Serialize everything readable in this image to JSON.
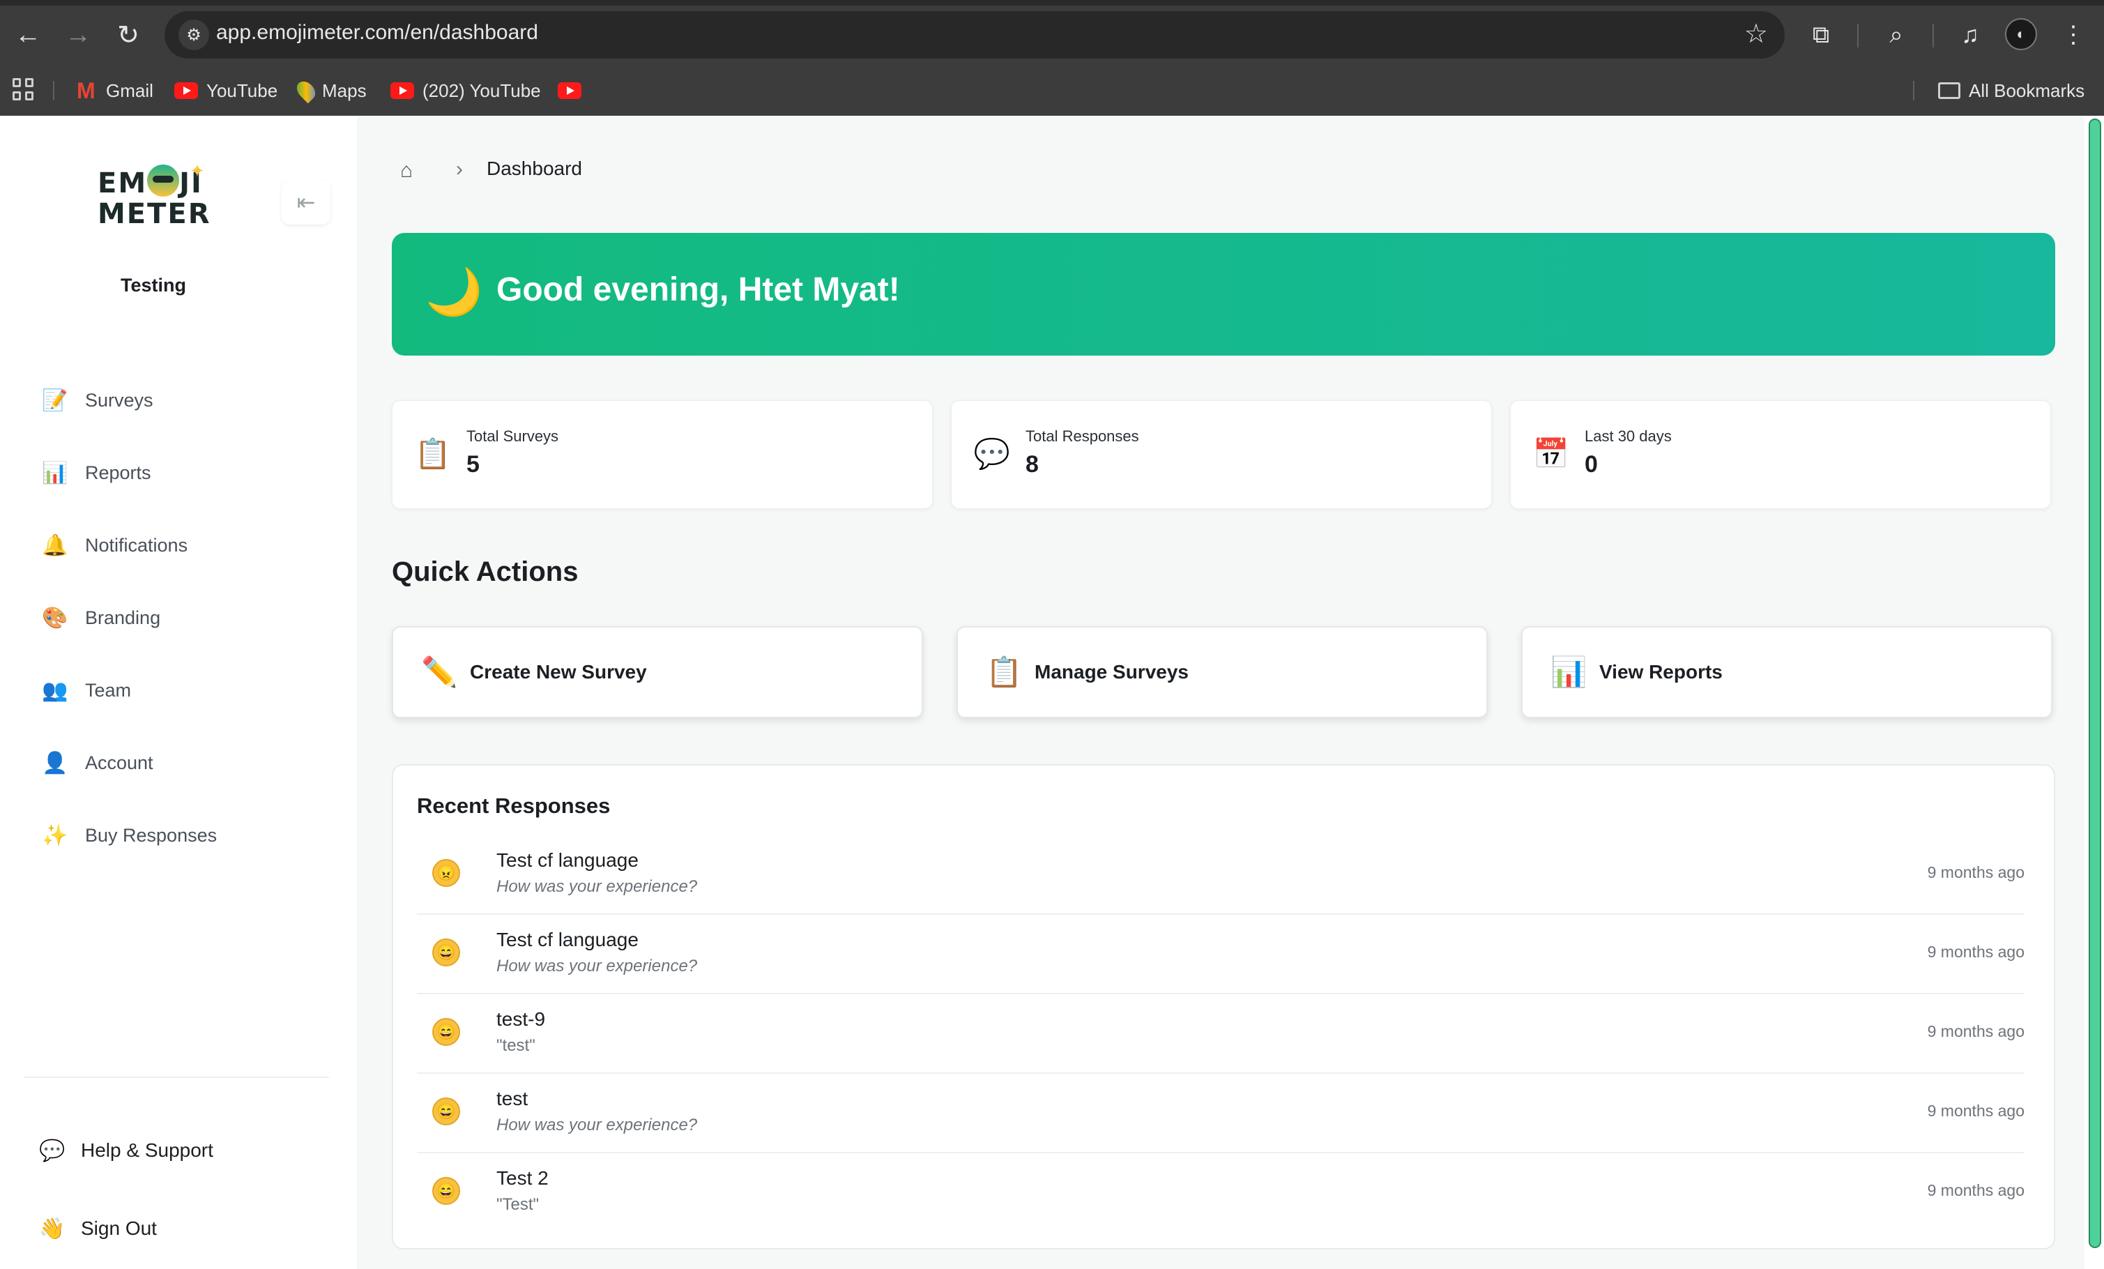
{
  "browser": {
    "url": "app.emojimeter.com/en/dashboard",
    "bookmarks": [
      {
        "label": "Gmail",
        "icon": "gmail-icon"
      },
      {
        "label": "YouTube",
        "icon": "youtube-icon"
      },
      {
        "label": "Maps",
        "icon": "maps-icon"
      },
      {
        "label": "(202) YouTube",
        "icon": "youtube-icon"
      },
      {
        "label": "",
        "icon": "youtube-icon"
      }
    ],
    "all_bookmarks_label": "All Bookmarks"
  },
  "sidebar": {
    "logo_top": "EM JI",
    "logo_bottom": "METER",
    "org_name": "Testing",
    "items": [
      {
        "label": "Surveys",
        "icon": "memo-icon",
        "glyph": "📝"
      },
      {
        "label": "Reports",
        "icon": "bar-chart-icon",
        "glyph": "📊"
      },
      {
        "label": "Notifications",
        "icon": "bell-icon",
        "glyph": "🔔"
      },
      {
        "label": "Branding",
        "icon": "palette-icon",
        "glyph": "🎨"
      },
      {
        "label": "Team",
        "icon": "team-icon",
        "glyph": "👥"
      },
      {
        "label": "Account",
        "icon": "user-icon",
        "glyph": "👤"
      },
      {
        "label": "Buy Responses",
        "icon": "sparkles-icon",
        "glyph": "✨"
      }
    ],
    "footer": [
      {
        "label": "Help & Support",
        "icon": "speech-bubble-icon",
        "glyph": "💬"
      },
      {
        "label": "Sign Out",
        "icon": "waving-hand-icon",
        "glyph": "👋"
      }
    ]
  },
  "breadcrumb": {
    "current": "Dashboard"
  },
  "greeting": {
    "text": "Good evening, Htet Myat!",
    "icon": "crescent-moon-icon",
    "glyph": "🌙"
  },
  "stats": [
    {
      "label": "Total Surveys",
      "value": "5",
      "icon": "clipboard-icon",
      "glyph": "📋"
    },
    {
      "label": "Total Responses",
      "value": "8",
      "icon": "speech-bubble-icon",
      "glyph": "💬"
    },
    {
      "label": "Last 30 days",
      "value": "0",
      "icon": "calendar-icon",
      "glyph": "📅"
    }
  ],
  "quick_actions": {
    "title": "Quick Actions",
    "items": [
      {
        "label": "Create New Survey",
        "icon": "pencil-icon",
        "glyph": "✏️"
      },
      {
        "label": "Manage Surveys",
        "icon": "clipboard-icon",
        "glyph": "📋"
      },
      {
        "label": "View Reports",
        "icon": "bar-chart-icon",
        "glyph": "📊"
      }
    ]
  },
  "recent_responses": {
    "title": "Recent Responses",
    "items": [
      {
        "title": "Test cf language",
        "subtitle": "How was your experience?",
        "time": "9 months ago",
        "face": "😠"
      },
      {
        "title": "Test cf language",
        "subtitle": "How was your experience?",
        "time": "9 months ago",
        "face": "😄"
      },
      {
        "title": "test-9",
        "subtitle": "\"test\"",
        "time": "9 months ago",
        "face": "😄"
      },
      {
        "title": "test",
        "subtitle": "How was your experience?",
        "time": "9 months ago",
        "face": "😄"
      },
      {
        "title": "Test 2",
        "subtitle": "\"Test\"",
        "time": "9 months ago",
        "face": "😄"
      }
    ]
  },
  "colors": {
    "hero_start": "#13ba7e",
    "hero_end": "#17b89c"
  }
}
